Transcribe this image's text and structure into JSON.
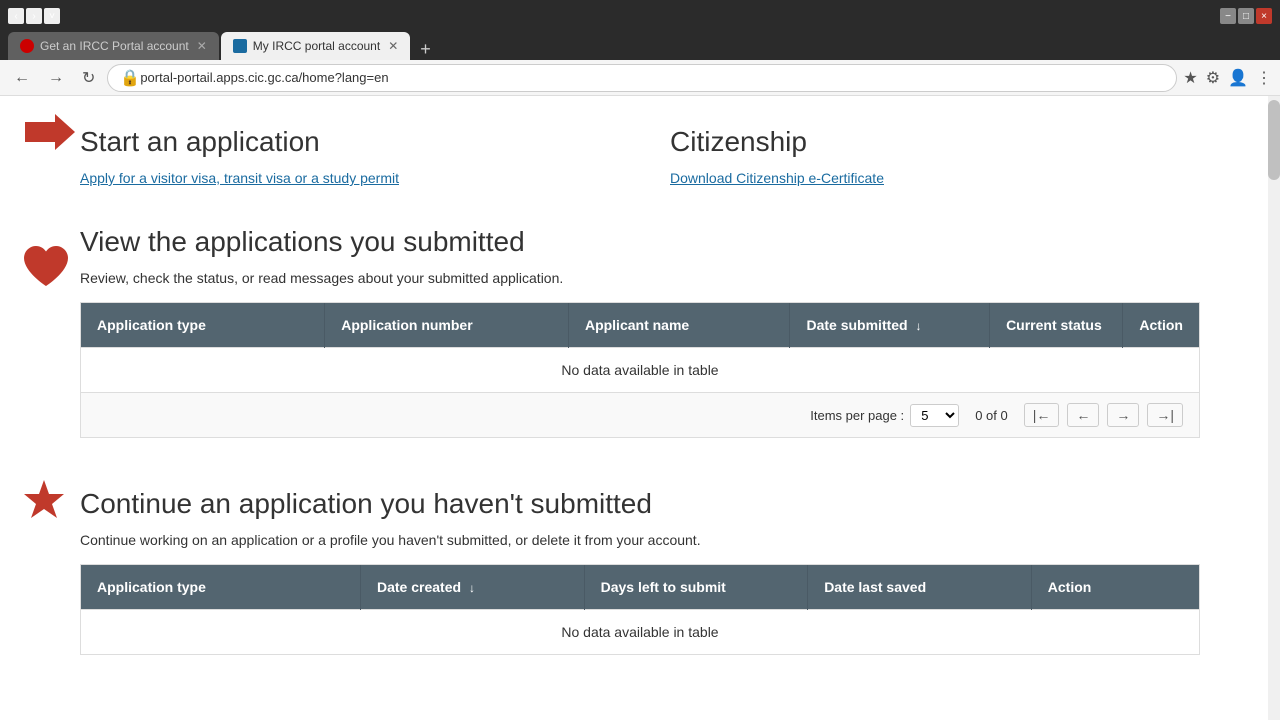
{
  "browser": {
    "tabs": [
      {
        "id": "tab1",
        "label": "Get an IRCC Portal account",
        "favicon_type": "red",
        "active": false
      },
      {
        "id": "tab2",
        "label": "My IRCC portal account",
        "favicon_type": "shield",
        "active": true
      }
    ],
    "add_tab_label": "+",
    "address": "portal-portail.apps.cic.gc.ca/home?lang=en",
    "window_controls": [
      "−",
      "□",
      "×"
    ]
  },
  "start_section": {
    "title": "Start an application",
    "link": "Apply for a visitor visa, transit visa or a study permit"
  },
  "citizenship_section": {
    "title": "Citizenship",
    "link": "Download Citizenship e-Certificate"
  },
  "submitted_section": {
    "title": "View the applications you submitted",
    "description": "Review, check the status, or read messages about your submitted application.",
    "table_headers": [
      {
        "key": "app_type",
        "label": "Application type"
      },
      {
        "key": "app_num",
        "label": "Application number"
      },
      {
        "key": "app_name",
        "label": "Applicant name"
      },
      {
        "key": "date_sub",
        "label": "Date submitted",
        "sort": "↓"
      },
      {
        "key": "status",
        "label": "Current status"
      },
      {
        "key": "action",
        "label": "Action"
      }
    ],
    "no_data_message": "No data available in table",
    "pagination": {
      "items_per_page_label": "Items per page :",
      "items_per_page_value": "5",
      "page_info": "0 of 0"
    }
  },
  "continue_section": {
    "title": "Continue an application you haven't submitted",
    "description": "Continue working on an application or a profile you haven't submitted, or delete it from your account.",
    "table_headers": [
      {
        "key": "app_type",
        "label": "Application type"
      },
      {
        "key": "date_created",
        "label": "Date created",
        "sort": "↓"
      },
      {
        "key": "days_left",
        "label": "Days left to submit"
      },
      {
        "key": "date_saved",
        "label": "Date last saved"
      },
      {
        "key": "action",
        "label": "Action"
      }
    ],
    "no_data_message": "No data available in table"
  }
}
